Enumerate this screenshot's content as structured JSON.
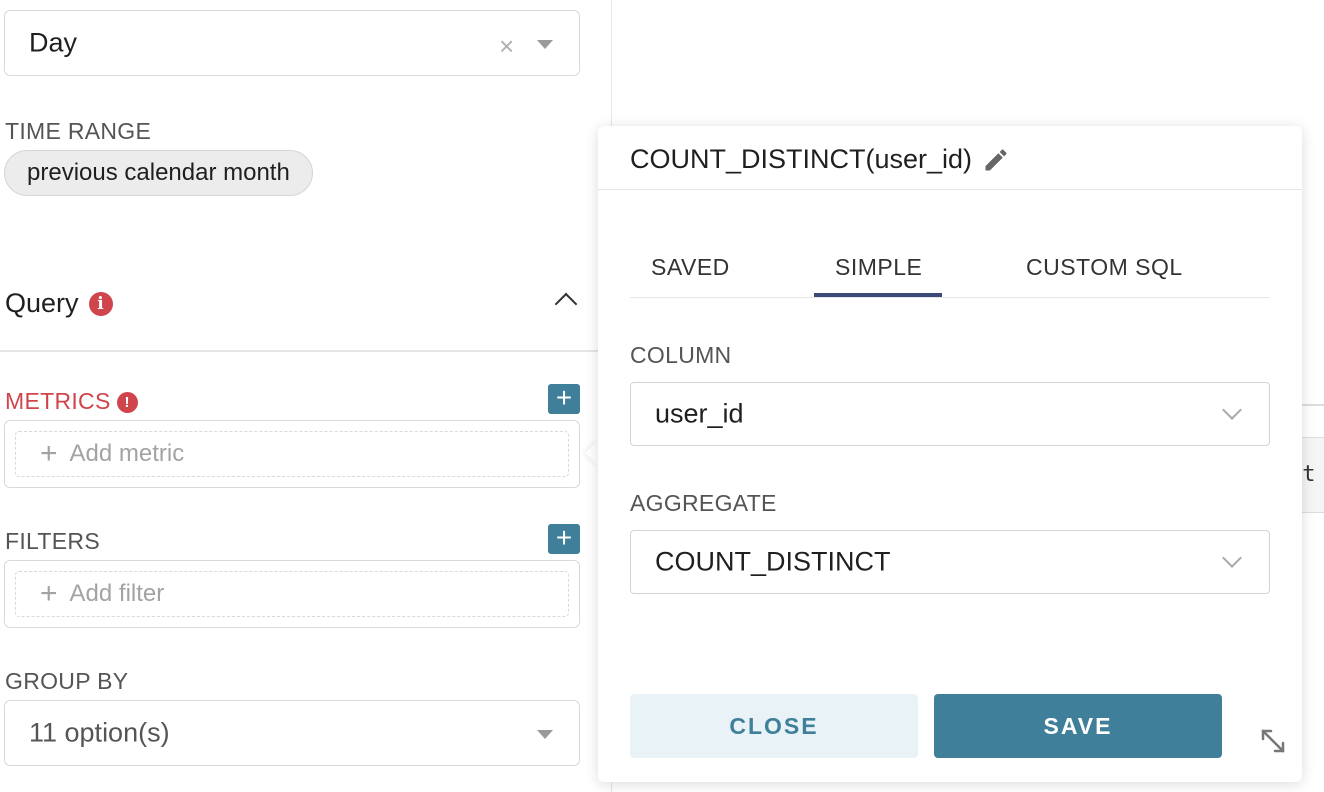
{
  "left_panel": {
    "time_grain": {
      "value": "Day"
    },
    "time_range": {
      "label": "TIME RANGE",
      "value": "previous calendar month"
    },
    "query_section": {
      "title": "Query"
    },
    "metrics": {
      "label": "METRICS",
      "placeholder": "Add metric"
    },
    "filters": {
      "label": "FILTERS",
      "placeholder": "Add filter"
    },
    "group_by": {
      "label": "GROUP BY",
      "value": "11 option(s)"
    }
  },
  "background": {
    "partial_text": "pt"
  },
  "popover": {
    "title": "COUNT_DISTINCT(user_id)",
    "tabs": [
      "SAVED",
      "SIMPLE",
      "CUSTOM SQL"
    ],
    "active_tab": "SIMPLE",
    "column": {
      "label": "COLUMN",
      "value": "user_id"
    },
    "aggregate": {
      "label": "AGGREGATE",
      "value": "COUNT_DISTINCT"
    },
    "close_label": "CLOSE",
    "save_label": "SAVE"
  },
  "colors": {
    "accent": "#3f7f9a",
    "error": "#d0454c",
    "tab_ink": "#3b4a78",
    "close_bg": "#e9f3f7"
  }
}
